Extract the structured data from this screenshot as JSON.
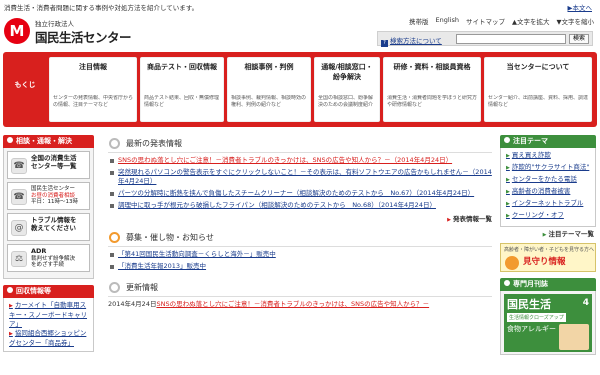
{
  "header": {
    "tagline": "消費生活・消費者問題に関する事例や対処方法を紹介しています。",
    "skip_link": "本文へ",
    "logo_sub": "独立行政法人",
    "logo_name": "国民生活センター",
    "logo_mark": "M",
    "utility": [
      "携帯版",
      "English",
      "サイトマップ",
      "▲文字を拡大",
      "▼文字を縮小"
    ],
    "search_help": "検索方法について",
    "search_placeholder": "",
    "search_button": "検索"
  },
  "gnav": {
    "title": "もくじ",
    "items": [
      {
        "label": "注目情報",
        "desc": "センターの発表情報、中央省庁からの情報、注目テーマなど"
      },
      {
        "label": "商品テスト・回収情報",
        "desc": "商品テスト結果、回収・無償修理情報など"
      },
      {
        "label": "相談事例・判例",
        "desc": "相談事例、裁判情報、相談時効の権利、判例の紹介など"
      },
      {
        "label": "通報/相談窓口・紛争解決",
        "desc": "全国の相談窓口、紛争解決のための会議制度紹介"
      },
      {
        "label": "研修・資料・相談員資格",
        "desc": "消費生活・消費者問題を学ぼうと研究方や研修情報など"
      },
      {
        "label": "当センターについて",
        "desc": "センター紹介、出前講座、資料、採用、調達情報など"
      }
    ]
  },
  "left": {
    "consult_title": "相談・通報・解決",
    "banners": [
      {
        "icon": "☎",
        "line1": "全国の消費生活",
        "line2": "センター等一覧"
      },
      {
        "icon": "☎",
        "line1": "国民生活センター",
        "line2": "お昼の消費者相談",
        "line3": "平日：11時～13時"
      },
      {
        "icon": "@",
        "line1": "トラブル情報を",
        "line2": "教えてください"
      },
      {
        "icon": "⚖",
        "line1": "ADR",
        "line2": "裁判せず紛争解決",
        "line3": "をめざす手続"
      }
    ],
    "recall_title": "回収情報等",
    "recall_items": [
      "カーメイト「自動車用スキー・スノーボードキャリア」",
      "協同組合西郷ショッピングセンター「商品券」"
    ]
  },
  "main": {
    "latest_title": "最新の発表情報",
    "latest": [
      {
        "text": "SNSの思わぬ落とし穴にご注意！－消費者トラブルのきっかけは、SNSの広告や知人から？－（2014年4月24日）",
        "highlight": true
      },
      {
        "text": "突然現れるパソコンの警告表示をすぐにクリックしないこと！－その表示は、有料ソフトウエアの広告かもしれません－（2014年4月24日）",
        "highlight": false
      },
      {
        "text": "パーツの分解時に断熱を挟んで負傷したスチームクリーナー（相談解決のためのテストから　No.67）（2014年4月24日）",
        "highlight": false
      },
      {
        "text": "調理中に取っ手が根元から破損したフライパン（相談解決のためのテストから　No.68）（2014年4月24日）",
        "highlight": false
      }
    ],
    "latest_more": "発表情報一覧",
    "events_title": "募集・催し物・お知らせ",
    "events": [
      "「第41回国民生活動向調査－くらしと海外－」販売中",
      "「消費生活年報2013」販売中"
    ],
    "updates_title": "更新情報",
    "update_date": "2014年4月24日",
    "update_link": "SNSの思わぬ落とし穴にご注意！－消費者トラブルのきっかけは、SNSの広告や知人から？－"
  },
  "right": {
    "topics_title": "注目テーマ",
    "topics": [
      "買え買え詐欺",
      "詐欺的\"サクラサイト商法\"",
      "センターをかたる電話",
      "高齢者の消費者被害",
      "インターネットトラブル",
      "クーリング・オフ"
    ],
    "topics_more": "注目テーマ一覧",
    "mimawari_top": "高齢者・障がい者・子どもを見守る方へ",
    "mimawari_big": "見守り情報",
    "magazine_title": "専門月刊誌",
    "mag_name": "国民生活",
    "mag_num": "4",
    "mag_sub": "生活情報クローズアップ",
    "mag_theme": "食物アレルギー"
  },
  "colors": {
    "brand_red": "#d8201e",
    "accent_green": "#3d8f3d",
    "link_blue": "#1a3c8c"
  }
}
